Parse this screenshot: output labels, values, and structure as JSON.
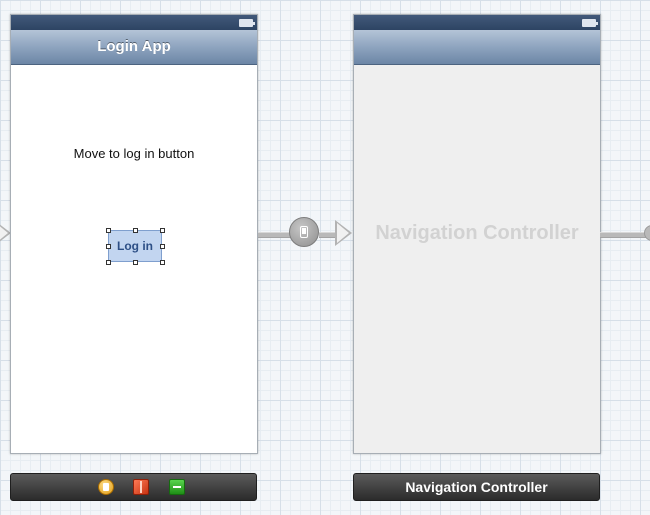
{
  "scenes": [
    {
      "nav_title": "Login App",
      "label": "Move to log in button",
      "button": "Log in"
    },
    {
      "nav_title": "",
      "placeholder": "Navigation Controller"
    }
  ],
  "docks": {
    "login_scene_icons": [
      "view-controller-icon",
      "first-responder-cube-icon",
      "exit-icon"
    ],
    "nav_scene_title": "Navigation Controller"
  },
  "segues": {
    "icon": "push-segue-icon"
  }
}
